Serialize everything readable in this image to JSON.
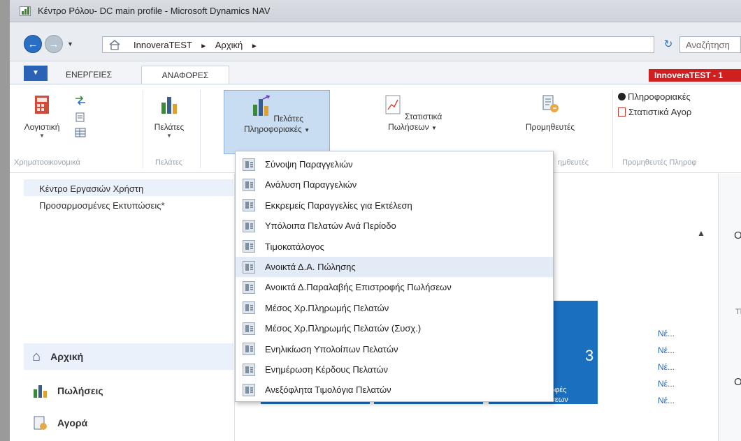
{
  "window": {
    "title": "Κέντρο Ρόλου- DC main profile - Microsoft Dynamics NAV"
  },
  "address": {
    "crumbs": [
      "InnoveraTEST",
      "Αρχική"
    ],
    "search_placeholder": "Αναζήτηση"
  },
  "ribbon": {
    "file_tab": "▼",
    "tabs": [
      "ΕΝΕΡΓΕΙΕΣ",
      "ΑΝΑΦΟΡΕΣ"
    ],
    "company_badge": "InnoveraTEST - 1",
    "buttons": {
      "accounting": "Λογιστική",
      "customers": "Πελάτες",
      "customers_info_line1": "Πελάτες",
      "customers_info_line2": "Πληροφοριακές",
      "sales_stats_line1": "Στατιστικά",
      "sales_stats_line2": "Πωλήσεων",
      "vendors": "Προμηθευτές",
      "vendor_info": "Πληροφοριακές",
      "purchase_stats": "Στατιστικά Αγορ"
    },
    "groups": {
      "finance": "Χρηματοοικονομικά",
      "customers": "Πελάτες",
      "vendors": "ημθευτές",
      "vendors_info": "Προμηθευτές Πληροφ"
    }
  },
  "leftnav": {
    "items": [
      "Κέντρο Εργασιών Χρήστη",
      "Προσαρμοσμένες Εκτυπώσεις*"
    ],
    "bottom": [
      "Αρχική",
      "Πωλήσεις",
      "Αγορά"
    ]
  },
  "main": {
    "tile_count": "3",
    "tile_text_1": "οφές",
    "tile_text_2": "σεων",
    "new_links": [
      "Νέ...",
      "Νέ...",
      "Νέ...",
      "Νέ...",
      "Νέ..."
    ],
    "right_letters": [
      "O",
      "O"
    ],
    "right_small": "Th"
  },
  "dropdown": {
    "items": [
      "Σύνοψη Παραγγελιών",
      "Ανάλυση Παραγγελιών",
      "Εκκρεμείς Παραγγελίες για Εκτέλεση",
      "Υπόλοιπα Πελατών Ανά Περίοδο",
      "Τιμοκατάλογος",
      "Ανοικτά Δ.Α. Πώλησης",
      "Ανοικτά Δ.Παραλαβής Επιστροφής Πωλήσεων",
      "Μέσος Χρ.Πληρωμής Πελατών",
      "Μέσος Χρ.Πληρωμής Πελατών (Συσχ.)",
      "Ενηλικίωση Υπολοίπων Πελατών",
      "Ενημέρωση Κέρδους Πελατών",
      "Ανεξόφλητα Τιμολόγια Πελατών"
    ],
    "highlighted_index": 5
  },
  "colors": {
    "accent": "#2b6fc5",
    "badge": "#cf1f1f",
    "tile": "#1b6fbf",
    "highlight": "#e2ebf6"
  }
}
